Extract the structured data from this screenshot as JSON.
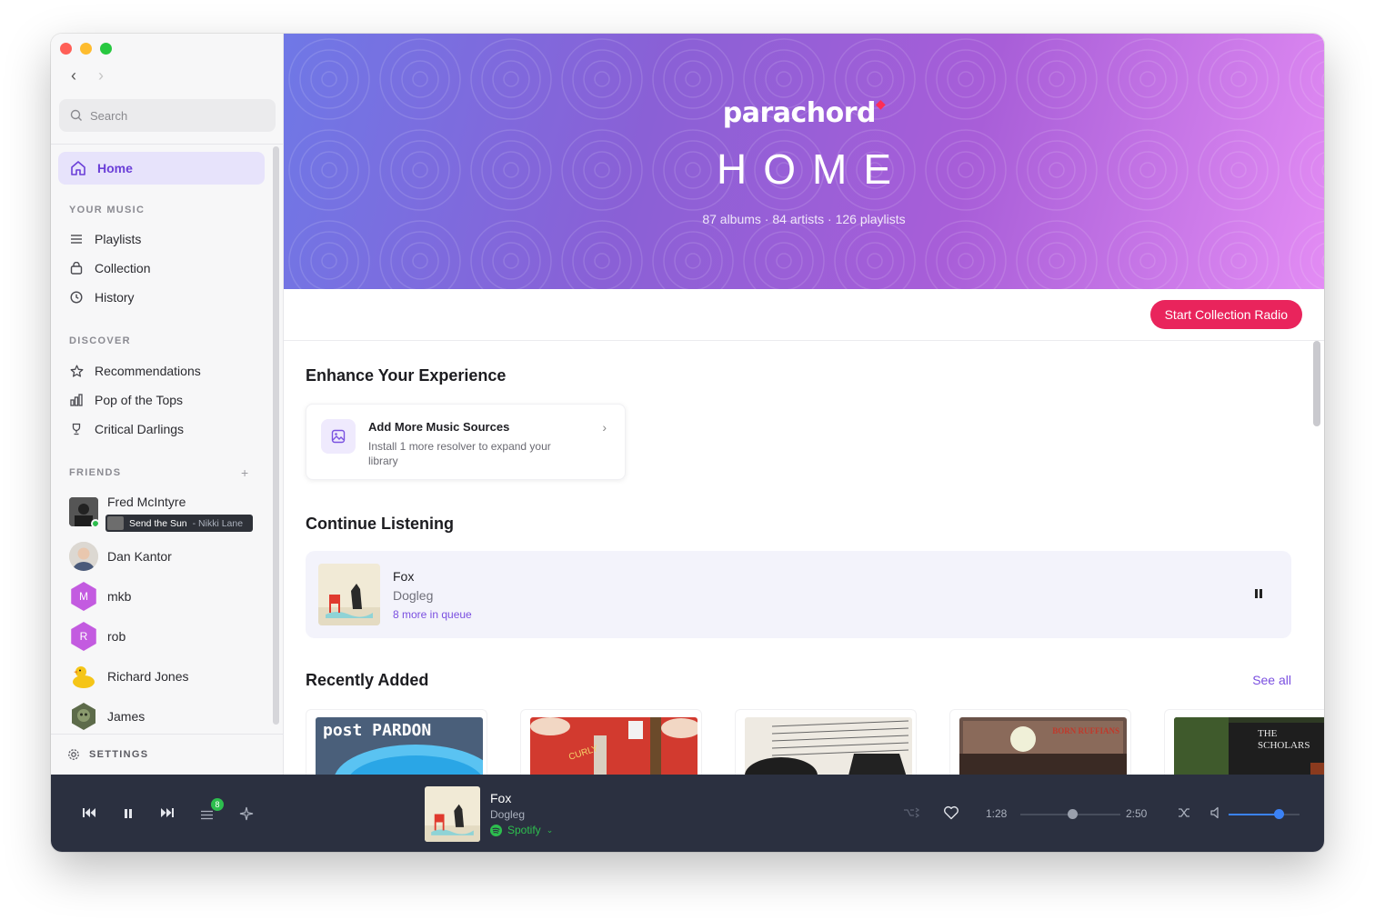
{
  "sidebar": {
    "search_placeholder": "Search",
    "home_label": "Home",
    "your_music_title": "YOUR MUSIC",
    "your_music_items": [
      {
        "label": "Playlists",
        "icon": "list-icon"
      },
      {
        "label": "Collection",
        "icon": "bag-icon"
      },
      {
        "label": "History",
        "icon": "clock-icon"
      }
    ],
    "discover_title": "DISCOVER",
    "discover_items": [
      {
        "label": "Recommendations",
        "icon": "star-icon"
      },
      {
        "label": "Pop of the Tops",
        "icon": "bar-chart-icon"
      },
      {
        "label": "Critical Darlings",
        "icon": "trophy-icon"
      }
    ],
    "friends_title": "FRIENDS",
    "friends": [
      {
        "name": "Fred McIntyre",
        "online": true,
        "now_playing_track": "Send the Sun",
        "now_playing_artist": "- Nikki Lane"
      },
      {
        "name": "Dan Kantor"
      },
      {
        "name": "mkb",
        "initial": "M"
      },
      {
        "name": "rob",
        "initial": "R"
      },
      {
        "name": "Richard Jones"
      },
      {
        "name": "James"
      }
    ],
    "settings_label": "SETTINGS"
  },
  "hero": {
    "logo": "parachord",
    "title": "HOME",
    "stats": "87 albums · 84 artists · 126 playlists"
  },
  "radio_button": "Start Collection Radio",
  "enhance": {
    "title": "Enhance Your Experience",
    "card_title": "Add More Music Sources",
    "card_desc": "Install 1 more resolver to expand your library"
  },
  "continue": {
    "title": "Continue Listening",
    "track": "Fox",
    "artist": "Dogleg",
    "queue": "8 more in queue"
  },
  "recent": {
    "title": "Recently Added",
    "see_all": "See all",
    "album_text": [
      "post PARDON",
      "CURLY",
      "",
      "BORN RUFFIANS",
      "THE SCHOLARS"
    ]
  },
  "player": {
    "queue_count": "8",
    "track": "Fox",
    "artist": "Dogleg",
    "source": "Spotify",
    "elapsed": "1:28",
    "duration": "2:50",
    "progress_fraction": 0.52,
    "volume_fraction": 0.7
  },
  "colors": {
    "accent": "#7a4fe0",
    "radio": "#e9245c",
    "spotify": "#2dbe4e",
    "volume": "#3b82f6",
    "player_bg": "#2b3040"
  }
}
